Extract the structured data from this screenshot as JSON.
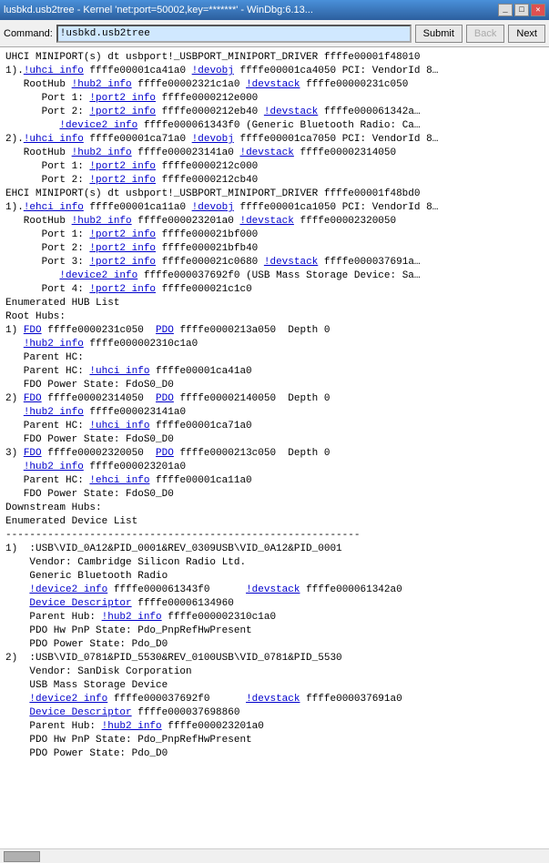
{
  "titleBar": {
    "title": "lusbkd.usb2tree - Kernel 'net:port=50002,key=*******' - WinDbg:6.13...",
    "minimizeLabel": "_",
    "maximizeLabel": "□",
    "closeLabel": "✕"
  },
  "toolbar": {
    "commandLabel": "Command:",
    "inputValue": "!usbkd.usb2tree",
    "buttons": [
      "Submit",
      "Back",
      "Next"
    ]
  },
  "content": {
    "lines": [
      {
        "type": "plain",
        "text": "UHCI MINIPORT(s) dt usbport!_USBPORT_MINIPORT_DRIVER ffffe00001f48010"
      },
      {
        "type": "plain",
        "text": ""
      },
      {
        "type": "mixed",
        "parts": [
          {
            "text": "1)."
          },
          {
            "text": "!uhci info",
            "link": true
          },
          {
            "text": " ffffe00001ca41a0 "
          },
          {
            "text": "!devobj",
            "link": true
          },
          {
            "text": " ffffe00001ca4050 PCI: VendorId 8…"
          }
        ]
      },
      {
        "type": "mixed",
        "parts": [
          {
            "text": "   RootHub "
          },
          {
            "text": "!hub2 info",
            "link": true
          },
          {
            "text": " ffffe00002321c1a0 "
          },
          {
            "text": "!devstack",
            "link": true
          },
          {
            "text": " ffffe00000231c050"
          }
        ]
      },
      {
        "type": "mixed",
        "parts": [
          {
            "text": "      Port 1: "
          },
          {
            "text": "!port2 info",
            "link": true
          },
          {
            "text": " ffffe0000212e000"
          }
        ]
      },
      {
        "type": "mixed",
        "parts": [
          {
            "text": "      Port 2: "
          },
          {
            "text": "!port2 info",
            "link": true
          },
          {
            "text": " ffffe0000212eb40 "
          },
          {
            "text": "!devstack",
            "link": true
          },
          {
            "text": " ffffe000061342a…"
          }
        ]
      },
      {
        "type": "mixed",
        "parts": [
          {
            "text": "         "
          },
          {
            "text": "!device2 info",
            "link": true
          },
          {
            "text": " ffffe000061343f0 (Generic Bluetooth Radio: Ca…"
          }
        ]
      },
      {
        "type": "plain",
        "text": ""
      },
      {
        "type": "mixed",
        "parts": [
          {
            "text": "2)."
          },
          {
            "text": "!uhci info",
            "link": true
          },
          {
            "text": " ffffe00001ca71a0 "
          },
          {
            "text": "!devobj",
            "link": true
          },
          {
            "text": " ffffe00001ca7050 PCI: VendorId 8…"
          }
        ]
      },
      {
        "type": "mixed",
        "parts": [
          {
            "text": "   RootHub "
          },
          {
            "text": "!hub2 info",
            "link": true
          },
          {
            "text": " ffffe000023141a0 "
          },
          {
            "text": "!devstack",
            "link": true
          },
          {
            "text": " ffffe00002314050"
          }
        ]
      },
      {
        "type": "mixed",
        "parts": [
          {
            "text": "      Port 1: "
          },
          {
            "text": "!port2 info",
            "link": true
          },
          {
            "text": " ffffe0000212c000"
          }
        ]
      },
      {
        "type": "mixed",
        "parts": [
          {
            "text": "      Port 2: "
          },
          {
            "text": "!port2 info",
            "link": true
          },
          {
            "text": " ffffe0000212cb40"
          }
        ]
      },
      {
        "type": "plain",
        "text": ""
      },
      {
        "type": "plain",
        "text": "EHCI MINIPORT(s) dt usbport!_USBPORT_MINIPORT_DRIVER ffffe00001f48bd0"
      },
      {
        "type": "plain",
        "text": ""
      },
      {
        "type": "mixed",
        "parts": [
          {
            "text": "1)."
          },
          {
            "text": "!ehci info",
            "link": true
          },
          {
            "text": " ffffe00001ca11a0 "
          },
          {
            "text": "!devobj",
            "link": true
          },
          {
            "text": " ffffe00001ca1050 PCI: VendorId 8…"
          }
        ]
      },
      {
        "type": "mixed",
        "parts": [
          {
            "text": "   RootHub "
          },
          {
            "text": "!hub2 info",
            "link": true
          },
          {
            "text": " ffffe000023201a0 "
          },
          {
            "text": "!devstack",
            "link": true
          },
          {
            "text": " ffffe00002320050"
          }
        ]
      },
      {
        "type": "mixed",
        "parts": [
          {
            "text": "      Port 1: "
          },
          {
            "text": "!port2 info",
            "link": true
          },
          {
            "text": " ffffe000021bf000"
          }
        ]
      },
      {
        "type": "mixed",
        "parts": [
          {
            "text": "      Port 2: "
          },
          {
            "text": "!port2 info",
            "link": true
          },
          {
            "text": " ffffe000021bfb40"
          }
        ]
      },
      {
        "type": "mixed",
        "parts": [
          {
            "text": "      Port 3: "
          },
          {
            "text": "!port2 info",
            "link": true
          },
          {
            "text": " ffffe000021c0680 "
          },
          {
            "text": "!devstack",
            "link": true
          },
          {
            "text": " ffffe000037691a…"
          }
        ]
      },
      {
        "type": "mixed",
        "parts": [
          {
            "text": "         "
          },
          {
            "text": "!device2 info",
            "link": true
          },
          {
            "text": " ffffe000037692f0 (USB Mass Storage Device: Sa…"
          }
        ]
      },
      {
        "type": "mixed",
        "parts": [
          {
            "text": "      Port 4: "
          },
          {
            "text": "!port2 info",
            "link": true
          },
          {
            "text": " ffffe000021c1c0"
          }
        ]
      },
      {
        "type": "plain",
        "text": ""
      },
      {
        "type": "plain",
        "text": "Enumerated HUB List"
      },
      {
        "type": "plain",
        "text": ""
      },
      {
        "type": "plain",
        "text": "Root Hubs:"
      },
      {
        "type": "mixed",
        "parts": [
          {
            "text": "1) "
          },
          {
            "text": "FDO",
            "link": true
          },
          {
            "text": " ffffe0000231c050  "
          },
          {
            "text": "PDO",
            "link": true
          },
          {
            "text": " ffffe0000213a050  Depth 0"
          }
        ]
      },
      {
        "type": "mixed",
        "parts": [
          {
            "text": "   "
          },
          {
            "text": "!hub2 info",
            "link": true
          },
          {
            "text": " ffffe000002310c1a0"
          }
        ]
      },
      {
        "type": "plain",
        "text": "   Parent HC: "
      },
      {
        "type": "mixed",
        "parts": [
          {
            "text": "   Parent HC: "
          },
          {
            "text": "!uhci info",
            "link": true
          },
          {
            "text": " ffffe00001ca41a0"
          }
        ]
      },
      {
        "type": "plain",
        "text": "   FDO Power State: FdoS0_D0"
      },
      {
        "type": "plain",
        "text": ""
      },
      {
        "type": "mixed",
        "parts": [
          {
            "text": "2) "
          },
          {
            "text": "FDO",
            "link": true
          },
          {
            "text": " ffffe00002314050  "
          },
          {
            "text": "PDO",
            "link": true
          },
          {
            "text": " ffffe00002140050  Depth 0"
          }
        ]
      },
      {
        "type": "mixed",
        "parts": [
          {
            "text": "   "
          },
          {
            "text": "!hub2 info",
            "link": true
          },
          {
            "text": " ffffe000023141a0"
          }
        ]
      },
      {
        "type": "mixed",
        "parts": [
          {
            "text": "   Parent HC: "
          },
          {
            "text": "!uhci info",
            "link": true
          },
          {
            "text": " ffffe00001ca71a0"
          }
        ]
      },
      {
        "type": "plain",
        "text": "   FDO Power State: FdoS0_D0"
      },
      {
        "type": "plain",
        "text": ""
      },
      {
        "type": "mixed",
        "parts": [
          {
            "text": "3) "
          },
          {
            "text": "FDO",
            "link": true
          },
          {
            "text": " ffffe00002320050  "
          },
          {
            "text": "PDO",
            "link": true
          },
          {
            "text": " ffffe0000213c050  Depth 0"
          }
        ]
      },
      {
        "type": "mixed",
        "parts": [
          {
            "text": "   "
          },
          {
            "text": "!hub2 info",
            "link": true
          },
          {
            "text": " ffffe000023201a0"
          }
        ]
      },
      {
        "type": "mixed",
        "parts": [
          {
            "text": "   Parent HC: "
          },
          {
            "text": "!ehci info",
            "link": true
          },
          {
            "text": " ffffe00001ca11a0"
          }
        ]
      },
      {
        "type": "plain",
        "text": "   FDO Power State: FdoS0_D0"
      },
      {
        "type": "plain",
        "text": ""
      },
      {
        "type": "plain",
        "text": ""
      },
      {
        "type": "plain",
        "text": "Downstream Hubs:"
      },
      {
        "type": "plain",
        "text": ""
      },
      {
        "type": "plain",
        "text": "Enumerated Device List"
      },
      {
        "type": "plain",
        "text": "-----------------------------------------------------------"
      },
      {
        "type": "plain",
        "text": "1)  :USB\\VID_0A12&PID_0001&REV_0309USB\\VID_0A12&PID_0001"
      },
      {
        "type": "plain",
        "text": "    Vendor: Cambridge Silicon Radio Ltd."
      },
      {
        "type": "plain",
        "text": "    Generic Bluetooth Radio"
      },
      {
        "type": "mixed",
        "parts": [
          {
            "text": "    "
          },
          {
            "text": "!device2 info",
            "link": true
          },
          {
            "text": " ffffe000061343f0      "
          },
          {
            "text": "!devstack",
            "link": true
          },
          {
            "text": " ffffe000061342a0"
          }
        ]
      },
      {
        "type": "mixed",
        "parts": [
          {
            "text": "    "
          },
          {
            "text": "Device Descriptor",
            "link": true
          },
          {
            "text": " ffffe00006134960"
          }
        ]
      },
      {
        "type": "mixed",
        "parts": [
          {
            "text": "    Parent Hub: "
          },
          {
            "text": "!hub2 info",
            "link": true
          },
          {
            "text": " ffffe000002310c1a0"
          }
        ]
      },
      {
        "type": "plain",
        "text": "    PDO Hw PnP State: Pdo_PnpRefHwPresent"
      },
      {
        "type": "plain",
        "text": "    PDO Power State: Pdo_D0"
      },
      {
        "type": "plain",
        "text": ""
      },
      {
        "type": "plain",
        "text": "2)  :USB\\VID_0781&PID_5530&REV_0100USB\\VID_0781&PID_5530"
      },
      {
        "type": "plain",
        "text": "    Vendor: SanDisk Corporation"
      },
      {
        "type": "plain",
        "text": "    USB Mass Storage Device"
      },
      {
        "type": "mixed",
        "parts": [
          {
            "text": "    "
          },
          {
            "text": "!device2 info",
            "link": true
          },
          {
            "text": " ffffe000037692f0      "
          },
          {
            "text": "!devstack",
            "link": true
          },
          {
            "text": " ffffe000037691a0"
          }
        ]
      },
      {
        "type": "mixed",
        "parts": [
          {
            "text": "    "
          },
          {
            "text": "Device Descriptor",
            "link": true
          },
          {
            "text": " ffffe000037698860"
          }
        ]
      },
      {
        "type": "mixed",
        "parts": [
          {
            "text": "    Parent Hub: "
          },
          {
            "text": "!hub2 info",
            "link": true
          },
          {
            "text": " ffffe000023201a0"
          }
        ]
      },
      {
        "type": "plain",
        "text": "    PDO Hw PnP State: Pdo_PnpRefHwPresent"
      },
      {
        "type": "plain",
        "text": "    PDO Power State: Pdo_D0"
      }
    ]
  }
}
